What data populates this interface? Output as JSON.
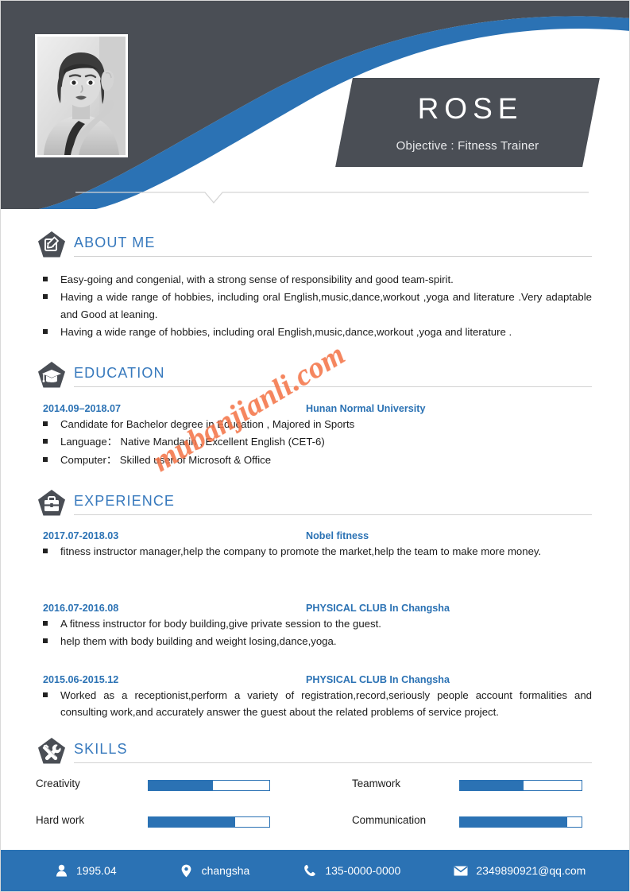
{
  "colors": {
    "accent_blue": "#2b72b4",
    "header_dark": "#4a4e55",
    "title_blue": "#3779bd",
    "watermark_orange": "#f4764a"
  },
  "header": {
    "name": "ROSE",
    "objective": "Objective : Fitness Trainer",
    "photo_alt": "portrait-photo"
  },
  "watermark": {
    "text": "mubanjianli.com"
  },
  "sections": {
    "about": {
      "title": "ABOUT ME",
      "icon": "document-pen-icon",
      "bullets": [
        "Easy-going and congenial, with a strong sense of responsibility and good team-spirit.",
        "Having a wide range of hobbies, including oral English,music,dance,workout ,yoga and literature .Very adaptable and Good at leaning.",
        "Having a wide range of hobbies, including oral English,music,dance,workout ,yoga and literature ."
      ]
    },
    "education": {
      "title": "EDUCATION",
      "icon": "graduation-cap-icon",
      "entries": [
        {
          "date": "2014.09–2018.07",
          "org": "Hunan Normal University",
          "bullets": [
            "Candidate for Bachelor degree in Education , Majored in Sports",
            "Language： Native Mandarin , Excellent English (CET-6)",
            "Computer： Skilled user of Microsoft & Office"
          ]
        }
      ]
    },
    "experience": {
      "title": "EXPERIENCE",
      "icon": "briefcase-icon",
      "entries": [
        {
          "date": "2017.07-2018.03",
          "org": "Nobel fitness",
          "bullets": [
            "fitness instructor manager,help the company to promote the   market,help the team to make more money."
          ]
        },
        {
          "date": "2016.07-2016.08",
          "org": "PHYSICAL CLUB In Changsha",
          "bullets": [
            "A fitness instructor for body building,give private session to the guest.",
            "help them with body building and weight losing,dance,yoga."
          ]
        },
        {
          "date": "2015.06-2015.12",
          "org": "PHYSICAL CLUB In Changsha",
          "bullets": [
            "Worked as a receptionist,perform a variety of registration,record,seriously people account formalities and consulting work,and accurately answer the guest about the related problems of service project."
          ]
        }
      ]
    },
    "skills": {
      "title": "SKILLS",
      "icon": "tools-icon",
      "items": [
        {
          "label": "Creativity",
          "percent": 53
        },
        {
          "label": "Teamwork",
          "percent": 52
        },
        {
          "label": "Hard work",
          "percent": 72
        },
        {
          "label": "Communication",
          "percent": 88
        }
      ]
    }
  },
  "footer": {
    "contacts": [
      {
        "icon": "person-icon",
        "value": "1995.04"
      },
      {
        "icon": "location-icon",
        "value": "changsha"
      },
      {
        "icon": "phone-icon",
        "value": "135-0000-0000"
      },
      {
        "icon": "envelope-icon",
        "value": "2349890921@qq.com"
      }
    ]
  }
}
